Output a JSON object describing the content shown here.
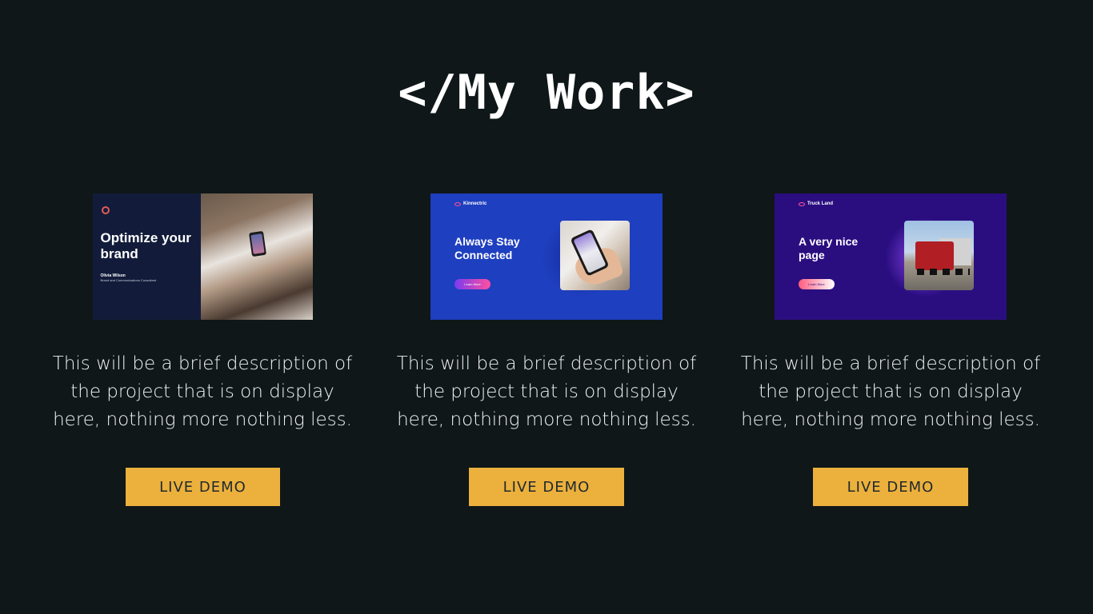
{
  "section": {
    "title": "</My Work>"
  },
  "projects": [
    {
      "thumbnail": {
        "headline": "Optimize your brand",
        "name": "Olivia Wilson",
        "role": "Brand and Communications Consultant"
      },
      "description": "This will be a brief description of the project that is on display here, nothing more nothing less.",
      "button_label": "LIVE DEMO"
    },
    {
      "thumbnail": {
        "brand": "Kinnectric",
        "headline": "Always Stay Connected",
        "cta": "Learn More"
      },
      "description": "This will be a brief description of the project that is on display here, nothing more nothing less.",
      "button_label": "LIVE DEMO"
    },
    {
      "thumbnail": {
        "brand": "Truck Land",
        "headline": "A very nice page",
        "cta": "Learn More"
      },
      "description": "This will be a brief description of the project that is on display here, nothing more nothing less.",
      "button_label": "LIVE DEMO"
    }
  ],
  "colors": {
    "background": "#0f1718",
    "button": "#ecb03d",
    "button_text": "#1e2a2d"
  }
}
